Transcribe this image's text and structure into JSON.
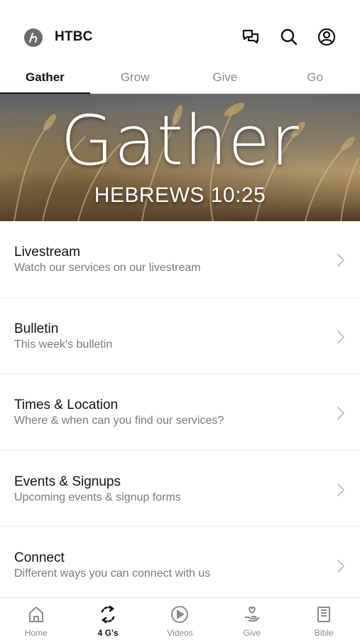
{
  "header": {
    "app_title": "HTBC",
    "logo_icon": "church-logo-icon",
    "icons": [
      "chat-icon",
      "search-icon",
      "account-icon"
    ]
  },
  "tabs": [
    {
      "label": "Gather",
      "active": true
    },
    {
      "label": "Grow",
      "active": false
    },
    {
      "label": "Give",
      "active": false
    },
    {
      "label": "Go",
      "active": false
    }
  ],
  "hero": {
    "title": "Gather",
    "subtitle": "HEBREWS 10:25"
  },
  "items": [
    {
      "title": "Livestream",
      "subtitle": "Watch our services on our livestream"
    },
    {
      "title": "Bulletin",
      "subtitle": "This week's bulletin"
    },
    {
      "title": "Times & Location",
      "subtitle": "Where & when can you find our services?"
    },
    {
      "title": "Events & Signups",
      "subtitle": "Upcoming events & signup forms"
    },
    {
      "title": "Connect",
      "subtitle": "Different ways you can connect with us"
    }
  ],
  "tabbar": [
    {
      "label": "Home",
      "icon": "home-icon",
      "active": false
    },
    {
      "label": "4 G's",
      "icon": "refresh-cycle-icon",
      "active": true
    },
    {
      "label": "Videos",
      "icon": "play-circle-icon",
      "active": false
    },
    {
      "label": "Give",
      "icon": "giving-hand-icon",
      "active": false
    },
    {
      "label": "Bible",
      "icon": "bible-icon",
      "active": false
    }
  ],
  "colors": {
    "accent": "#111111",
    "muted_text": "#7a7a7a",
    "divider": "#ececec"
  }
}
